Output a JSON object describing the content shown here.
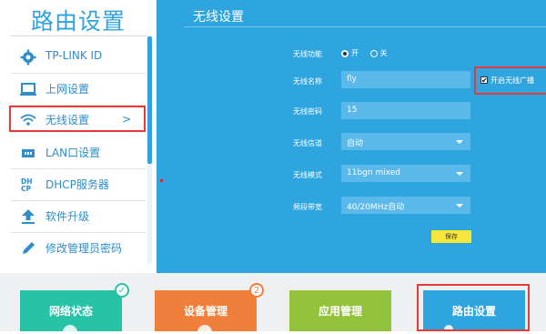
{
  "sidebar": {
    "title": "路由设置",
    "items": [
      {
        "label": "TP-LINK ID",
        "icon": "gear-icon"
      },
      {
        "label": "上网设置",
        "icon": "monitor-icon"
      },
      {
        "label": "无线设置",
        "icon": "wifi-icon",
        "active": true,
        "chevron": ">"
      },
      {
        "label": "LAN口设置",
        "icon": "network-icon"
      },
      {
        "label": "DHCP服务器",
        "icon": "dhcp-icon",
        "icon_text": "DH\nCP"
      },
      {
        "label": "软件升级",
        "icon": "upgrade-icon"
      },
      {
        "label": "修改管理员密码",
        "icon": "pencil-icon"
      }
    ]
  },
  "main": {
    "title": "无线设置",
    "wireless_function": {
      "label": "无线功能",
      "on_label": "开",
      "off_label": "关",
      "selected": "on"
    },
    "ssid": {
      "label": "无线名称",
      "value": "fly"
    },
    "broadcast": {
      "label": "开启无线广播",
      "checked": true
    },
    "password": {
      "label": "无线密码",
      "value": "15"
    },
    "channel": {
      "label": "无线信道",
      "value": "自动"
    },
    "mode": {
      "label": "无线模式",
      "value": "11bgn mixed"
    },
    "bandwidth": {
      "label": "频段带宽",
      "value": "40/20MHz自动"
    },
    "save_label": "保存"
  },
  "bottom_tiles": [
    {
      "label": "网络状态",
      "color": "#27c3a6",
      "badge": "✓"
    },
    {
      "label": "设备管理",
      "color": "#f07f3c",
      "badge": "2"
    },
    {
      "label": "应用管理",
      "color": "#93c23d"
    },
    {
      "label": "路由设置",
      "color": "#2fa5e0"
    }
  ],
  "colors": {
    "accent": "#2fa3df",
    "panel": "#2fa5e0",
    "highlight": "#e83a3a",
    "save": "#f6e73a"
  }
}
